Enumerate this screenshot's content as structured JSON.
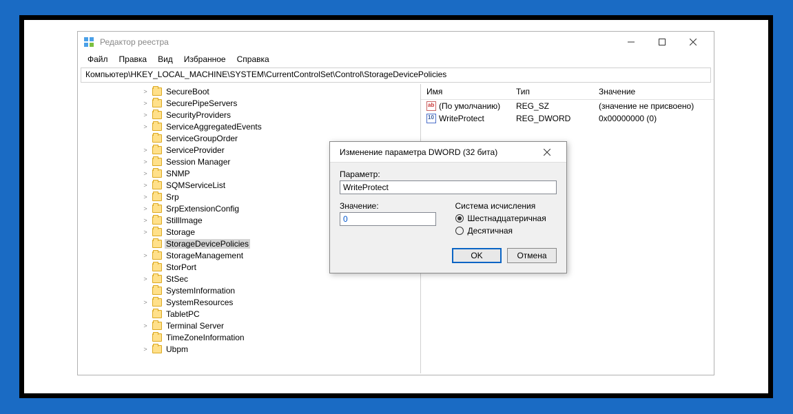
{
  "window": {
    "title": "Редактор реестра",
    "menu": [
      "Файл",
      "Правка",
      "Вид",
      "Избранное",
      "Справка"
    ],
    "path": "Компьютер\\HKEY_LOCAL_MACHINE\\SYSTEM\\CurrentControlSet\\Control\\StorageDevicePolicies"
  },
  "tree": [
    {
      "label": "SecureBoot",
      "chev": ">"
    },
    {
      "label": "SecurePipeServers",
      "chev": ">"
    },
    {
      "label": "SecurityProviders",
      "chev": ">"
    },
    {
      "label": "ServiceAggregatedEvents",
      "chev": ">"
    },
    {
      "label": "ServiceGroupOrder",
      "chev": ""
    },
    {
      "label": "ServiceProvider",
      "chev": ">"
    },
    {
      "label": "Session Manager",
      "chev": ">"
    },
    {
      "label": "SNMP",
      "chev": ">"
    },
    {
      "label": "SQMServiceList",
      "chev": ">"
    },
    {
      "label": "Srp",
      "chev": ">"
    },
    {
      "label": "SrpExtensionConfig",
      "chev": ">"
    },
    {
      "label": "StillImage",
      "chev": ">"
    },
    {
      "label": "Storage",
      "chev": ">"
    },
    {
      "label": "StorageDevicePolicies",
      "chev": "",
      "selected": true
    },
    {
      "label": "StorageManagement",
      "chev": ">"
    },
    {
      "label": "StorPort",
      "chev": ""
    },
    {
      "label": "StSec",
      "chev": ">"
    },
    {
      "label": "SystemInformation",
      "chev": ""
    },
    {
      "label": "SystemResources",
      "chev": ">"
    },
    {
      "label": "TabletPC",
      "chev": ""
    },
    {
      "label": "Terminal Server",
      "chev": ">"
    },
    {
      "label": "TimeZoneInformation",
      "chev": ""
    },
    {
      "label": "Ubpm",
      "chev": ">"
    }
  ],
  "list": {
    "headers": [
      "Имя",
      "Тип",
      "Значение"
    ],
    "rows": [
      {
        "icon": "sz",
        "name": "(По умолчанию)",
        "type": "REG_SZ",
        "value": "(значение не присвоено)"
      },
      {
        "icon": "dw",
        "name": "WriteProtect",
        "type": "REG_DWORD",
        "value": "0x00000000 (0)"
      }
    ]
  },
  "dialog": {
    "title": "Изменение параметра DWORD (32 бита)",
    "param_label": "Параметр:",
    "param_value": "WriteProtect",
    "value_label": "Значение:",
    "value_value": "0",
    "radix_label": "Система исчисления",
    "radix_hex": "Шестнадцатеричная",
    "radix_dec": "Десятичная",
    "ok": "OK",
    "cancel": "Отмена"
  }
}
